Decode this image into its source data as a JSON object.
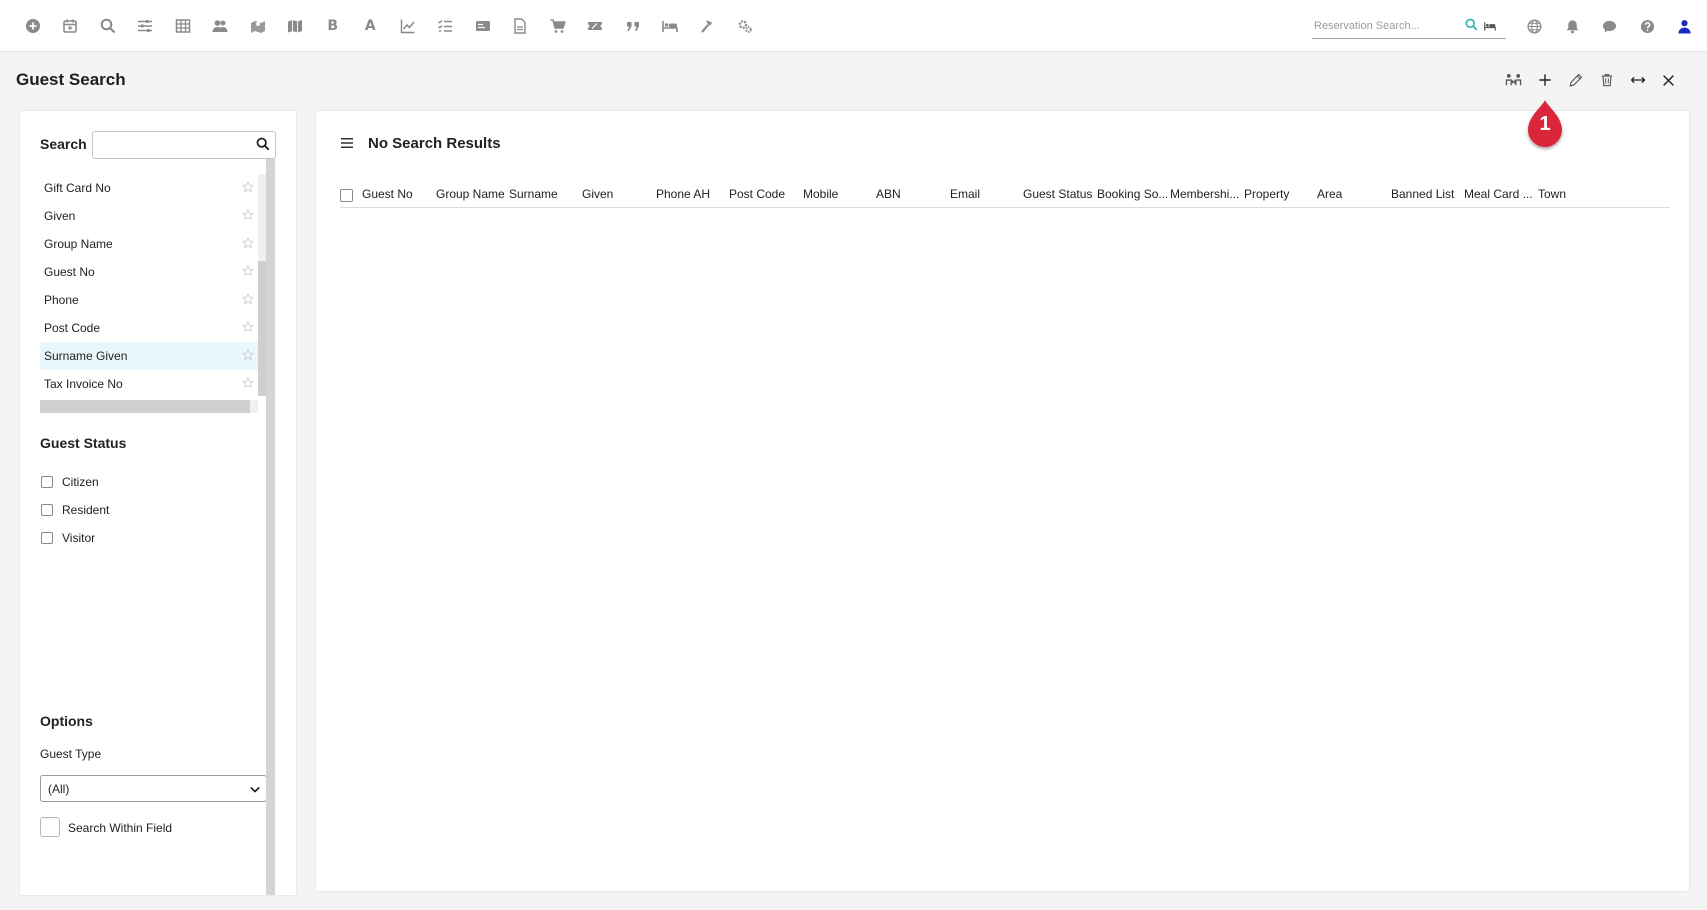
{
  "toolbar": {
    "icons": [
      "plus-circle-icon",
      "calendar-icon",
      "search-icon",
      "sliders-icon",
      "table-icon",
      "users-icon",
      "map-pin-icon",
      "map-icon",
      "bold-b-icon",
      "letter-a-icon",
      "line-chart-icon",
      "checklist-icon",
      "id-card-icon",
      "document-icon",
      "cart-icon",
      "ticket-icon",
      "quote-icon",
      "bed-icon",
      "hammer-icon",
      "cogs-icon"
    ],
    "bold_letter": "B",
    "a_letter": "A",
    "reservation_search_placeholder": "Reservation Search...",
    "right_icons": [
      "globe-icon",
      "bell-icon",
      "chat-icon",
      "help-icon",
      "user-icon"
    ]
  },
  "page": {
    "title": "Guest Search"
  },
  "header_actions": [
    "merge-guests-icon",
    "add-icon",
    "edit-icon",
    "delete-icon",
    "expand-icon",
    "close-icon"
  ],
  "callout": {
    "number": "1",
    "color": "#d9283a"
  },
  "left_panel": {
    "search_label": "Search",
    "search_value": "",
    "fields": [
      {
        "label": "Gift Card No"
      },
      {
        "label": "Given"
      },
      {
        "label": "Group Name"
      },
      {
        "label": "Guest No"
      },
      {
        "label": "Phone"
      },
      {
        "label": "Post Code"
      },
      {
        "label": "Surname Given"
      },
      {
        "label": "Tax Invoice No"
      }
    ],
    "selected_field": "Surname Given",
    "guest_status_title": "Guest Status",
    "guest_status_options": [
      "Citizen",
      "Resident",
      "Visitor"
    ],
    "options_title": "Options",
    "guest_type_label": "Guest Type",
    "guest_type_value": "(All)",
    "search_within_label": "Search Within Field"
  },
  "main_panel": {
    "status_text": "No Search Results",
    "columns": [
      "Guest No",
      "Group Name",
      "Surname",
      "Given",
      "Phone AH",
      "Post Code",
      "Mobile",
      "ABN",
      "Email",
      "Guest Status",
      "Booking So...",
      "Membershi...",
      "Property",
      "Area",
      "Banned List",
      "Meal Card ...",
      "Town"
    ]
  },
  "colors": {
    "accent": "#2bb3b3",
    "user_icon": "#1a2bc4",
    "selected_row": "#e7f7fb"
  }
}
